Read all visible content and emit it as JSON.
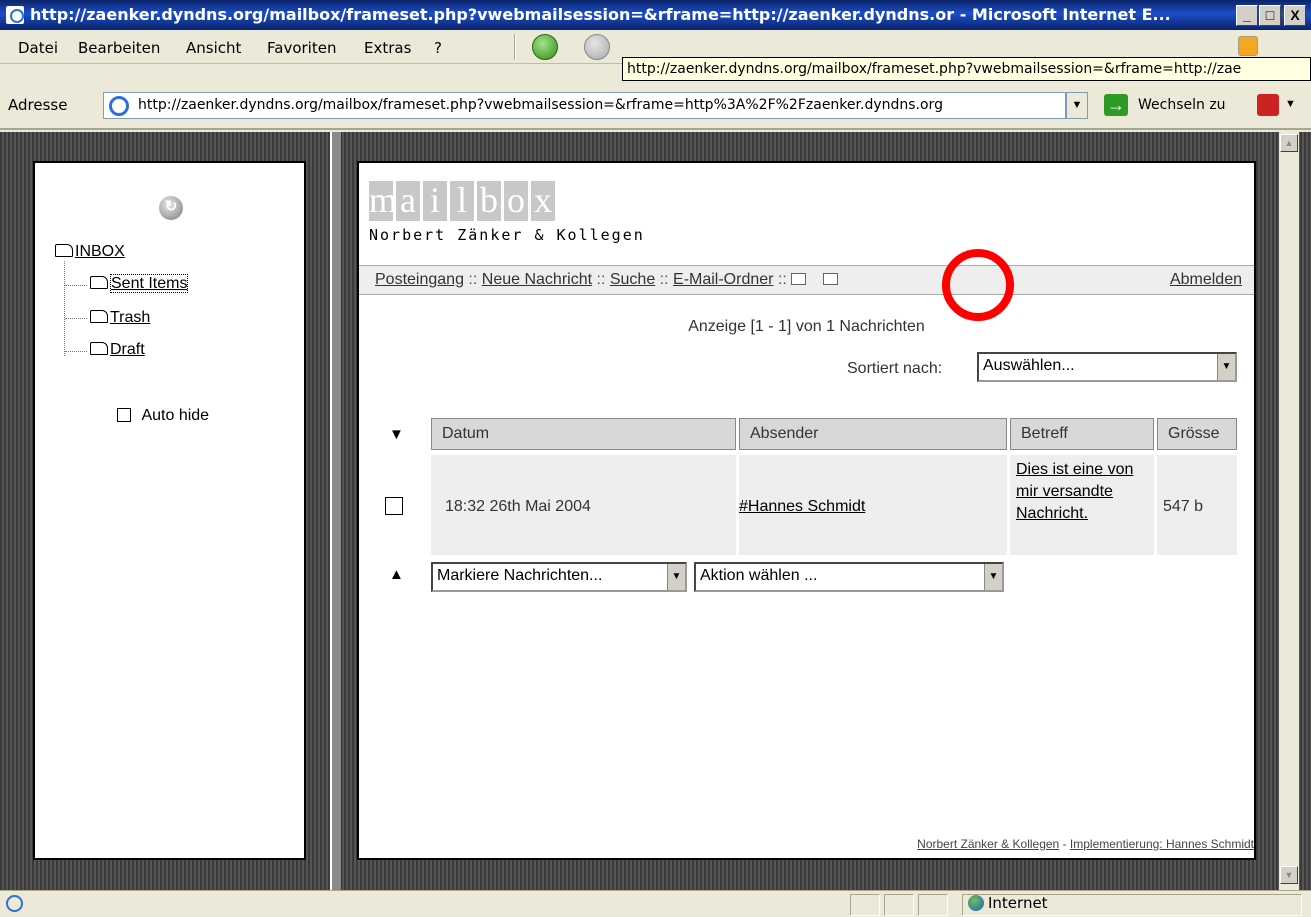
{
  "window": {
    "title": "http://zaenker.dyndns.org/mailbox/frameset.php?vwebmailsession=&rframe=http://zaenker.dyndns.or - Microsoft Internet E...",
    "min_label": "_",
    "max_label": "□",
    "close_label": "X"
  },
  "menubar": {
    "items": [
      "Datei",
      "Bearbeiten",
      "Ansicht",
      "Favoriten",
      "Extras",
      "?"
    ]
  },
  "tooltip": "http://zaenker.dyndns.org/mailbox/frameset.php?vwebmailsession=&rframe=http://zae",
  "address": {
    "label": "Adresse",
    "url": "http://zaenker.dyndns.org/mailbox/frameset.php?vwebmailsession=&rframe=http%3A%2F%2Fzaenker.dyndns.org",
    "go_label": "Wechseln zu"
  },
  "sidebar": {
    "folders": [
      "INBOX",
      "Sent Items",
      "Trash",
      "Draft"
    ],
    "auto_hide_label": "Auto hide"
  },
  "mail": {
    "logo_letters": [
      "m",
      "a",
      "i",
      "l",
      "b",
      "o",
      "x"
    ],
    "company": "Norbert Zänker & Kollegen",
    "nav": {
      "inbox": "Posteingang",
      "new_message": "Neue Nachricht",
      "search": "Suche",
      "folders": "E-Mail-Ordner",
      "separator": "::",
      "logout": "Abmelden"
    },
    "count_text": "Anzeige [1 - 1] von 1 Nachrichten",
    "sort_label": "Sortiert nach:",
    "sort_value": "Auswählen...",
    "columns": [
      "Datum",
      "Absender",
      "Betreff",
      "Grösse"
    ],
    "rows": [
      {
        "date": "18:32 26th Mai 2004",
        "sender": "#Hannes Schmidt",
        "subject": "Dies ist eine von mir versandte Nachricht.",
        "size": "547 b"
      }
    ],
    "mark_select": "Markiere Nachrichten...",
    "action_select": "Aktion wählen ...",
    "footer_company": "Norbert Zänker & Kollegen",
    "footer_sep": " - ",
    "footer_impl": "Implementierung: Hannes Schmidt"
  },
  "statusbar": {
    "zone": "Internet"
  },
  "colors": {
    "titlebar": "#0a246a",
    "annotation_circle": "#ff0000"
  }
}
